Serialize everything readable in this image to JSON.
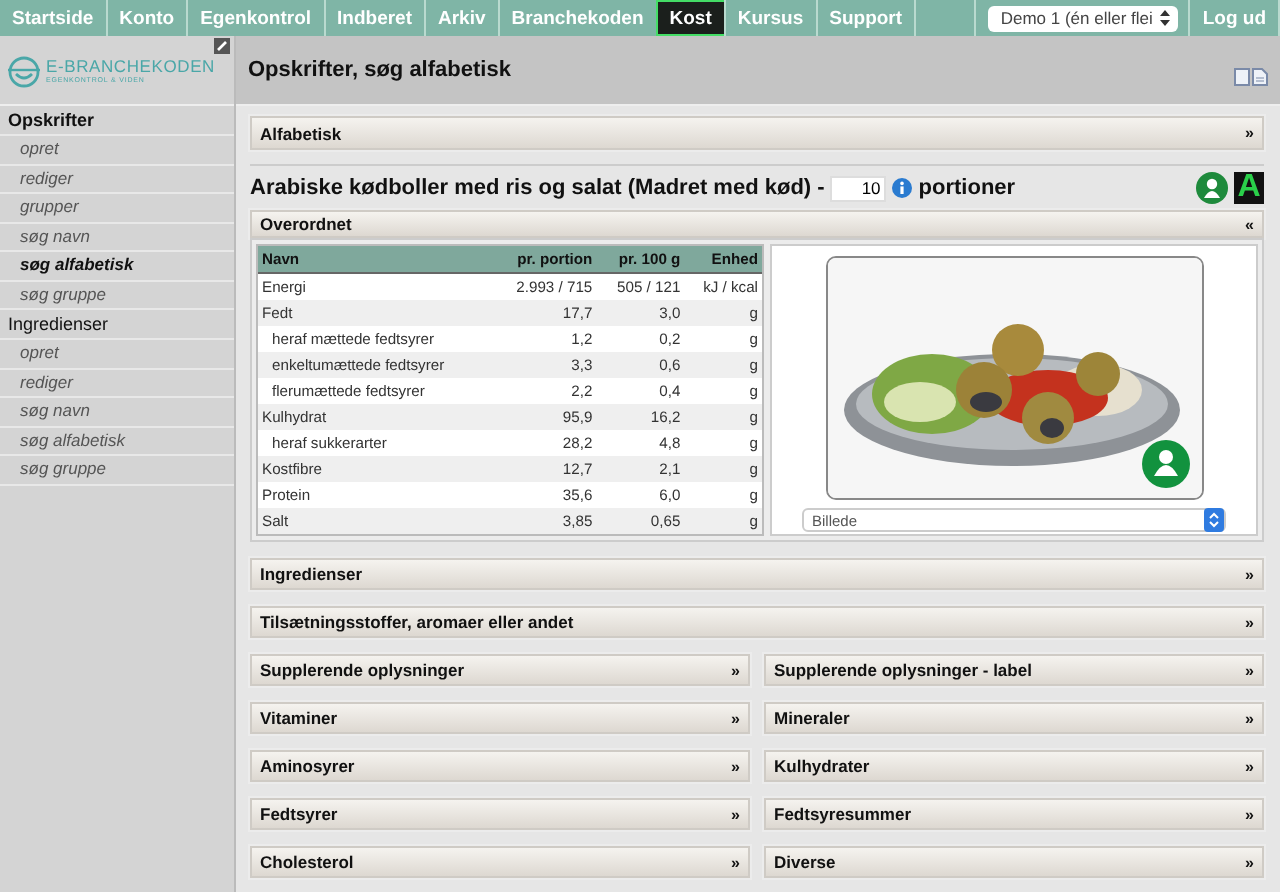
{
  "nav": {
    "tabs": [
      {
        "label": "Startside",
        "selected": false
      },
      {
        "label": "Konto",
        "selected": false
      },
      {
        "label": "Egenkontrol",
        "selected": false
      },
      {
        "label": "Indberet",
        "selected": false
      },
      {
        "label": "Arkiv",
        "selected": false
      },
      {
        "label": "Branchekoden",
        "selected": false
      },
      {
        "label": "Kost",
        "selected": true
      },
      {
        "label": "Kursus",
        "selected": false
      },
      {
        "label": "Support",
        "selected": false
      }
    ],
    "account_select": "Demo 1 (én eller flei",
    "logout": "Log ud"
  },
  "logo": {
    "name": "E-BRANCHEKODEN",
    "tagline": "EGENKONTROL & VIDEN"
  },
  "sidebar": {
    "groups": [
      {
        "label": "Opskrifter",
        "selected": true,
        "items": [
          {
            "label": "opret",
            "selected": false
          },
          {
            "label": "rediger",
            "selected": false
          },
          {
            "label": "grupper",
            "selected": false
          },
          {
            "label": "søg navn",
            "selected": false
          },
          {
            "label": "søg alfabetisk",
            "selected": true
          },
          {
            "label": "søg gruppe",
            "selected": false
          }
        ]
      },
      {
        "label": "Ingredienser",
        "selected": false,
        "items": [
          {
            "label": "opret",
            "selected": false
          },
          {
            "label": "rediger",
            "selected": false
          },
          {
            "label": "søg navn",
            "selected": false
          },
          {
            "label": "søg alfabetisk",
            "selected": false
          },
          {
            "label": "søg gruppe",
            "selected": false
          }
        ]
      }
    ]
  },
  "page_title": "Opskrifter, søg alfabetisk",
  "filter_panel": {
    "label": "Alfabetisk",
    "toggle": "»"
  },
  "recipe": {
    "title": "Arabiske kødboller med ris og salat (Madret med kød) -",
    "portions": "10",
    "portions_label": "portioner",
    "badge_letter": "A"
  },
  "overview": {
    "label": "Overordnet",
    "toggle": "«",
    "table": {
      "columns": [
        "Navn",
        "pr. portion",
        "pr. 100 g",
        "Enhed"
      ],
      "rows": [
        {
          "cells": [
            "Energi",
            "2.993 / 715",
            "505 / 121",
            "kJ / kcal"
          ]
        },
        {
          "cells": [
            "Fedt",
            "17,7",
            "3,0",
            "g"
          ],
          "children": [
            {
              "cells": [
                "heraf mættede fedtsyrer",
                "1,2",
                "0,2",
                "g"
              ]
            },
            {
              "cells": [
                "enkeltumættede fedtsyrer",
                "3,3",
                "0,6",
                "g"
              ]
            },
            {
              "cells": [
                "flerumættede fedtsyrer",
                "2,2",
                "0,4",
                "g"
              ]
            }
          ]
        },
        {
          "cells": [
            "Kulhydrat",
            "95,9",
            "16,2",
            "g"
          ],
          "children": [
            {
              "cells": [
                "heraf sukkerarter",
                "28,2",
                "4,8",
                "g"
              ]
            }
          ]
        },
        {
          "cells": [
            "Kostfibre",
            "12,7",
            "2,1",
            "g"
          ]
        },
        {
          "cells": [
            "Protein",
            "35,6",
            "6,0",
            "g"
          ]
        },
        {
          "cells": [
            "Salt",
            "3,85",
            "0,65",
            "g"
          ]
        }
      ]
    },
    "image_select": "Billede"
  },
  "sections": [
    {
      "label": "Ingredienser",
      "toggle": "»",
      "kind": "full"
    },
    {
      "label": "Tilsætningsstoffer, aromaer eller andet",
      "toggle": "»",
      "kind": "full"
    },
    {
      "label": "Supplerende oplysninger",
      "toggle": "»",
      "kind": "half"
    },
    {
      "label": "Supplerende oplysninger - label",
      "toggle": "»",
      "kind": "half"
    },
    {
      "label": "Vitaminer",
      "toggle": "»",
      "kind": "half"
    },
    {
      "label": "Mineraler",
      "toggle": "»",
      "kind": "half"
    },
    {
      "label": "Aminosyrer",
      "toggle": "»",
      "kind": "half"
    },
    {
      "label": "Kulhydrater",
      "toggle": "»",
      "kind": "half"
    },
    {
      "label": "Fedtsyrer",
      "toggle": "»",
      "kind": "half"
    },
    {
      "label": "Fedtsyresummer",
      "toggle": "»",
      "kind": "half"
    },
    {
      "label": "Cholesterol",
      "toggle": "»",
      "kind": "half"
    },
    {
      "label": "Diverse",
      "toggle": "»",
      "kind": "half"
    }
  ]
}
